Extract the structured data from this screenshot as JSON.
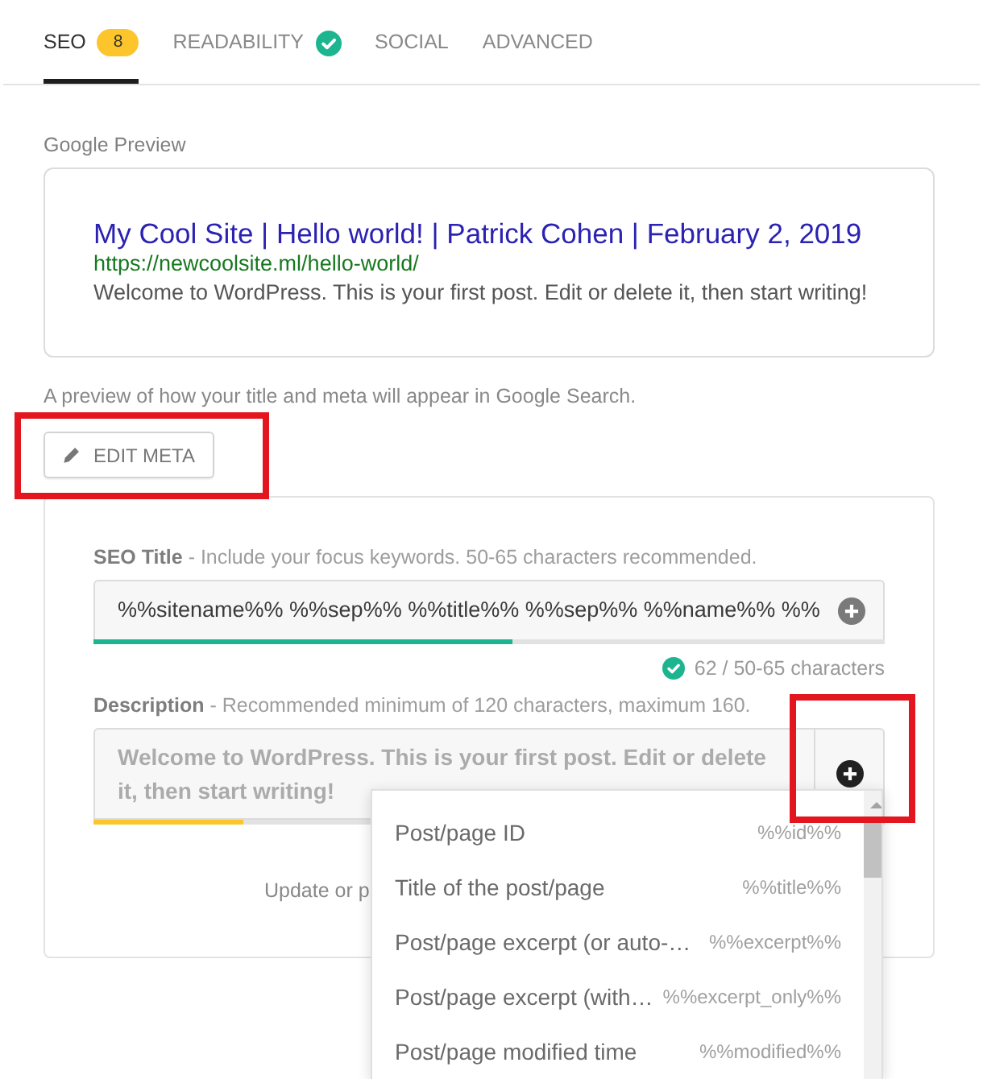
{
  "tabs": [
    {
      "label": "SEO",
      "selected": true,
      "badge": "8"
    },
    {
      "label": "READABILITY",
      "selected": false,
      "passed": true
    },
    {
      "label": "SOCIAL",
      "selected": false
    },
    {
      "label": "ADVANCED",
      "selected": false
    }
  ],
  "google_preview": {
    "heading": "Google Preview",
    "title": "My Cool Site | Hello world! | Patrick Cohen | February 2, 2019",
    "url": "https://newcoolsite.ml/hello-world/",
    "description": "Welcome to WordPress. This is your first post. Edit or delete it, then start writing!",
    "caption": "A preview of how your title and meta will appear in Google Search."
  },
  "edit_meta_button": {
    "label": "EDIT META",
    "highlighted": true
  },
  "seo_title": {
    "label": "**SEO Title** - Include your focus keywords. 50-65 characters recommended.",
    "value": "%%sitename%% %%sep%% %%title%% %%sep%% %%name%% %%",
    "within_range": true,
    "level": 0.53,
    "counter": "62 / 50-65 characters",
    "insert_button": {
      "expanded": false
    }
  },
  "description": {
    "label": "**Description** - Recommended minimum of 120 characters, maximum 160.",
    "placeholder": "Welcome to WordPress. This is your first post. Edit or delete it, then start writing!",
    "within_range": false,
    "level": 0.19,
    "insert_button": {
      "expanded": true,
      "highlighted": true,
      "menu": [
        {
          "label": "Post/page ID",
          "variable": "%%id%%"
        },
        {
          "label": "Title of the post/page",
          "variable": "%%title%%"
        },
        {
          "label": "Post/page excerpt (or auto-…",
          "variable": "%%excerpt%%"
        },
        {
          "label": "Post/page excerpt (with…",
          "variable": "%%excerpt_only%%"
        },
        {
          "label": "Post/page modified time",
          "variable": "%%modified%%"
        }
      ]
    }
  },
  "footer_note": "Update or p"
}
